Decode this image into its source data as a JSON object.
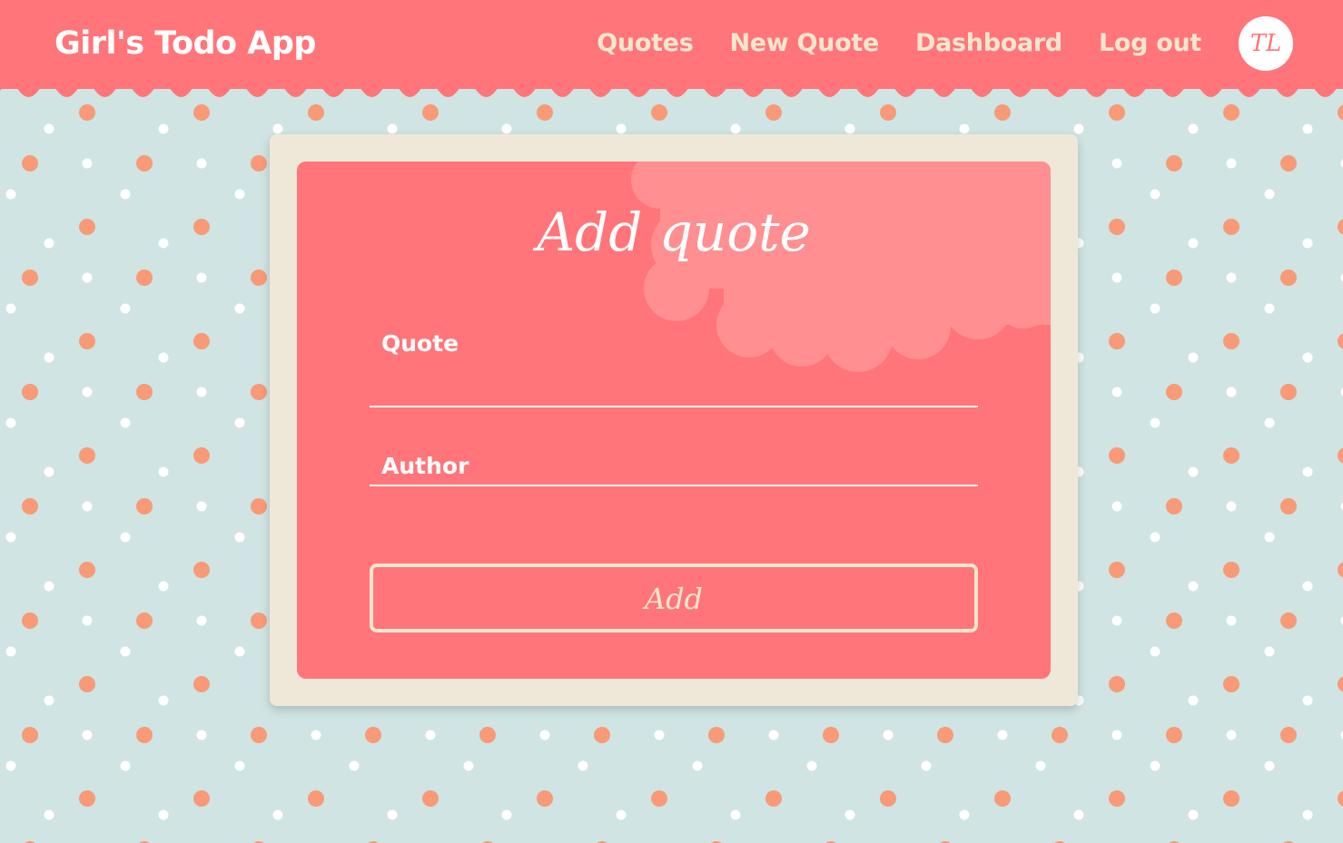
{
  "header": {
    "brand": "Girl's Todo App",
    "nav": [
      "Quotes",
      "New Quote",
      "Dashboard",
      "Log out"
    ],
    "avatar_initials": "TL"
  },
  "form": {
    "title": "Add quote",
    "quote_label": "Quote",
    "author_label": "Author",
    "quote_value": "",
    "author_value": "",
    "submit_label": "Add"
  },
  "colors": {
    "primary": "#ff7579",
    "cream": "#f2e6cf",
    "card_border": "#efe8d9",
    "background": "#cfe4e3",
    "dot_orange": "#f89a77",
    "dot_white": "#ffffff",
    "cloud": "#ff8f91"
  },
  "icons": {
    "avatar": "user-avatar-icon"
  }
}
